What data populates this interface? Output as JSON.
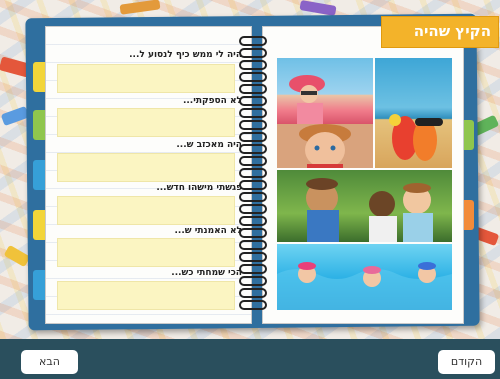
{
  "header": {
    "title": "הקיץ שהיה"
  },
  "notebook": {
    "prompts": [
      {
        "text": "היה לי ממש כיף לנסוע ל...",
        "answer": ""
      },
      {
        "text": "לא הספקתי...",
        "answer": ""
      },
      {
        "text": "היה מאכזב ש...",
        "answer": ""
      },
      {
        "text": "פגשתי מישהו חדש...",
        "answer": ""
      },
      {
        "text": "לא האמנתי ש...",
        "answer": ""
      },
      {
        "text": "הכי שמחתי כש...",
        "answer": ""
      }
    ]
  },
  "navigation": {
    "next_label": "הבא",
    "previous_label": "הקודם"
  },
  "colors": {
    "title_bg": "#f3b32a",
    "answer_bg": "#fbf5c2",
    "bottom_bar": "#2a4f5d",
    "cover": "#2f6f9f"
  }
}
